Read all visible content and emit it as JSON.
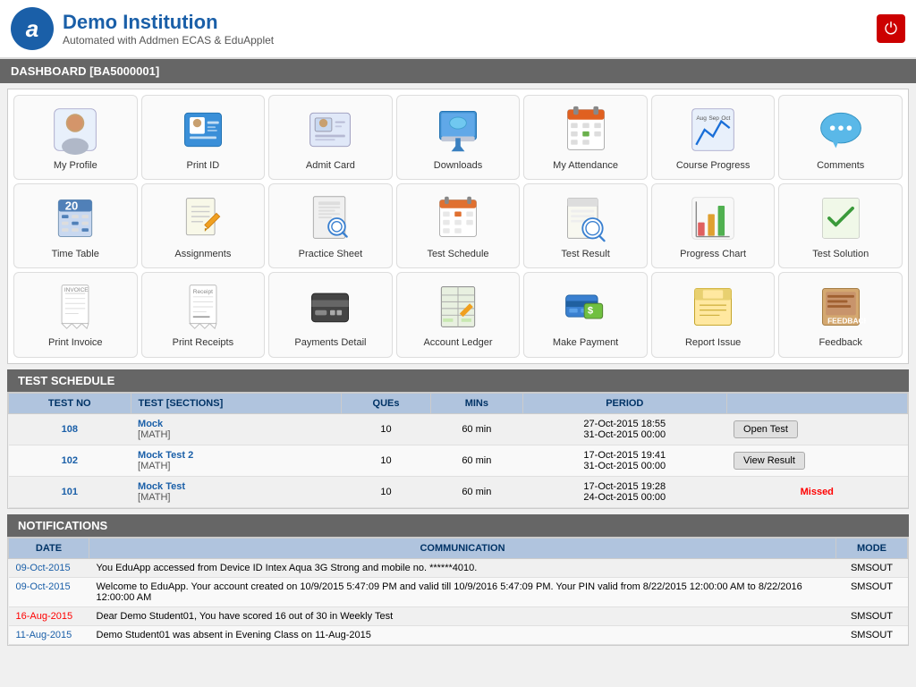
{
  "header": {
    "logo_letter": "a",
    "title": "Demo Institution",
    "subtitle": "Automated with Addmen ECAS & EduApplet",
    "power_icon": "⏻"
  },
  "dashboard_bar": {
    "label": "DASHBOARD [BA5000001]"
  },
  "icons": {
    "row1": [
      {
        "id": "my-profile",
        "label": "My Profile",
        "icon_type": "profile"
      },
      {
        "id": "print-id",
        "label": "Print ID",
        "icon_type": "print-id"
      },
      {
        "id": "admit-card",
        "label": "Admit Card",
        "icon_type": "admit-card"
      },
      {
        "id": "downloads",
        "label": "Downloads",
        "icon_type": "downloads"
      },
      {
        "id": "my-attendance",
        "label": "My Attendance",
        "icon_type": "attendance"
      },
      {
        "id": "course-progress",
        "label": "Course Progress",
        "icon_type": "course-progress"
      },
      {
        "id": "comments",
        "label": "Comments",
        "icon_type": "comments"
      }
    ],
    "row2": [
      {
        "id": "time-table",
        "label": "Time Table",
        "icon_type": "timetable"
      },
      {
        "id": "assignments",
        "label": "Assignments",
        "icon_type": "assignments"
      },
      {
        "id": "practice-sheet",
        "label": "Practice Sheet",
        "icon_type": "practice-sheet"
      },
      {
        "id": "test-schedule",
        "label": "Test Schedule",
        "icon_type": "test-schedule"
      },
      {
        "id": "test-result",
        "label": "Test Result",
        "icon_type": "test-result"
      },
      {
        "id": "progress-chart",
        "label": "Progress Chart",
        "icon_type": "progress-chart"
      },
      {
        "id": "test-solution",
        "label": "Test Solution",
        "icon_type": "test-solution"
      }
    ],
    "row3": [
      {
        "id": "print-invoice",
        "label": "Print Invoice",
        "icon_type": "invoice"
      },
      {
        "id": "print-receipts",
        "label": "Print Receipts",
        "icon_type": "receipt"
      },
      {
        "id": "payments-detail",
        "label": "Payments Detail",
        "icon_type": "payments"
      },
      {
        "id": "account-ledger",
        "label": "Account Ledger",
        "icon_type": "ledger"
      },
      {
        "id": "make-payment",
        "label": "Make Payment",
        "icon_type": "make-payment"
      },
      {
        "id": "report-issue",
        "label": "Report Issue",
        "icon_type": "report-issue"
      },
      {
        "id": "feedback",
        "label": "Feedback",
        "icon_type": "feedback"
      }
    ]
  },
  "test_schedule": {
    "section_label": "TEST SCHEDULE",
    "columns": [
      "TEST NO",
      "TEST [SECTIONS]",
      "QUEs",
      "MINs",
      "PERIOD",
      ""
    ],
    "rows": [
      {
        "test_no": "108",
        "test_name": "Mock",
        "section": "[MATH]",
        "ques": "10",
        "mins": "60 min",
        "period": "27-Oct-2015 18:55\n31-Oct-2015 00:00",
        "action": "Open Test",
        "action_type": "open"
      },
      {
        "test_no": "102",
        "test_name": "Mock Test 2",
        "section": "[MATH]",
        "ques": "10",
        "mins": "60 min",
        "period": "17-Oct-2015 19:41\n31-Oct-2015 00:00",
        "action": "View Result",
        "action_type": "view"
      },
      {
        "test_no": "101",
        "test_name": "Mock Test",
        "section": "[MATH]",
        "ques": "10",
        "mins": "60 min",
        "period": "17-Oct-2015 19:28\n24-Oct-2015 00:00",
        "action": "Missed",
        "action_type": "missed"
      }
    ]
  },
  "notifications": {
    "section_label": "NOTIFICATIONS",
    "columns": [
      "DATE",
      "COMMUNICATION",
      "MODE"
    ],
    "rows": [
      {
        "date": "09-Oct-2015",
        "date_style": "normal",
        "message": "You EduApp accessed from Device ID Intex Aqua 3G Strong and mobile no. ******4010.",
        "mode": "SMSOUT"
      },
      {
        "date": "09-Oct-2015",
        "date_style": "normal",
        "message": "Welcome to EduApp. Your account created on 10/9/2015 5:47:09 PM and valid till 10/9/2016 5:47:09 PM. Your PIN valid from 8/22/2015 12:00:00 AM to 8/22/2016 12:00:00 AM",
        "mode": "SMSOUT"
      },
      {
        "date": "16-Aug-2015",
        "date_style": "red",
        "message": "Dear Demo Student01, You have scored 16 out of 30 in Weekly Test",
        "mode": "SMSOUT"
      },
      {
        "date": "11-Aug-2015",
        "date_style": "normal",
        "message": "Demo Student01 was absent in Evening Class on 11-Aug-2015",
        "mode": "SMSOUT"
      }
    ]
  }
}
